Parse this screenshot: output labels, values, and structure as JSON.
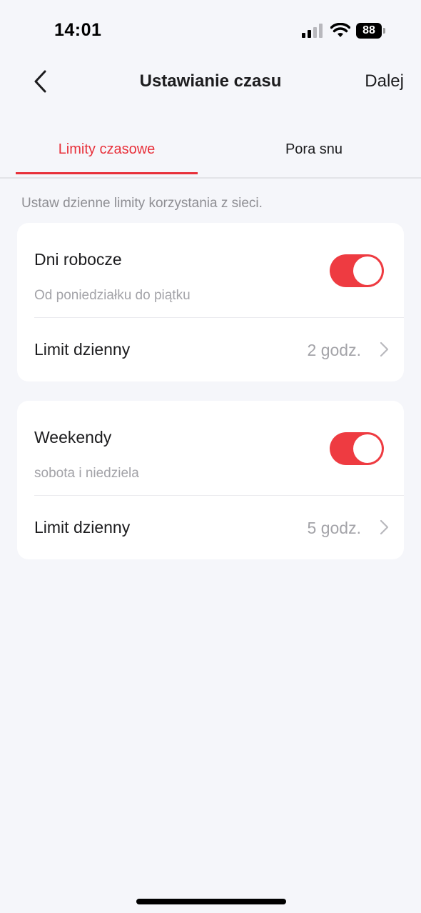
{
  "status_bar": {
    "time": "14:01",
    "battery": "88"
  },
  "header": {
    "title": "Ustawianie czasu",
    "next_label": "Dalej"
  },
  "tabs": [
    {
      "label": "Limity czasowe",
      "active": true
    },
    {
      "label": "Pora snu",
      "active": false
    }
  ],
  "description": "Ustaw dzienne limity korzystania z sieci.",
  "cards": [
    {
      "title": "Dni robocze",
      "subtitle": "Od poniedziałku do piątku",
      "enabled": true,
      "limit_label": "Limit dzienny",
      "limit_value": "2 godz."
    },
    {
      "title": "Weekendy",
      "subtitle": "sobota i niedziela",
      "enabled": true,
      "limit_label": "Limit dzienny",
      "limit_value": "5 godz."
    }
  ],
  "colors": {
    "accent": "#e8303a",
    "toggle_on": "#ee3b41",
    "background": "#f5f6fa",
    "secondary_text": "#a3a3a8"
  }
}
